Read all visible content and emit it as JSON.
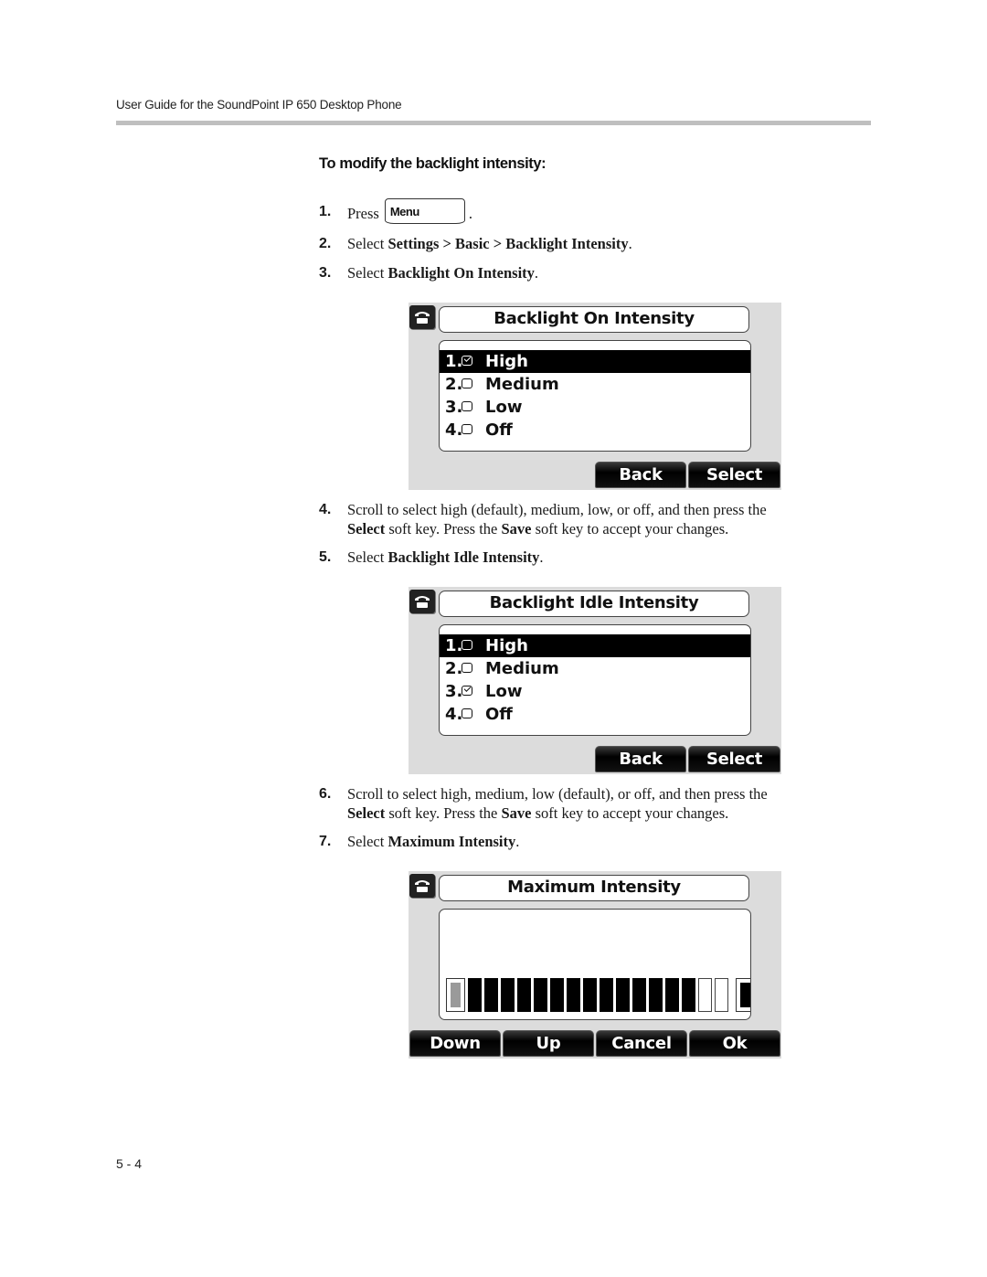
{
  "header": {
    "running_title": "User Guide for the SoundPoint IP 650 Desktop Phone"
  },
  "procedure": {
    "title": "To modify the backlight intensity:",
    "steps": [
      {
        "num": "1.",
        "pre": "Press",
        "key_label": "Menu",
        "post": "."
      },
      {
        "num": "2.",
        "pre": "Select ",
        "bold": "Settings > Basic > Backlight Intensity",
        "post": "."
      },
      {
        "num": "3.",
        "pre": "Select ",
        "bold": "Backlight On Intensity",
        "post": "."
      },
      {
        "num": "4.",
        "line1": "Scroll to select high (default), medium, low, or off, and then press the",
        "bold1": "Select",
        "mid": " soft key. Press the ",
        "bold2": "Save",
        "post": " soft key to accept your changes."
      },
      {
        "num": "5.",
        "pre": "Select ",
        "bold": "Backlight Idle Intensity",
        "post": "."
      },
      {
        "num": "6.",
        "line1": "Scroll to select high, medium, low (default), or off, and then press the",
        "bold1": "Select",
        "mid": " soft key. Press the ",
        "bold2": "Save",
        "post": " soft key to accept your changes."
      },
      {
        "num": "7.",
        "pre": "Select ",
        "bold": "Maximum Intensity",
        "post": "."
      }
    ]
  },
  "screens": [
    {
      "title": "Backlight On Intensity",
      "icon": "phone-handset-icon",
      "options": [
        {
          "idx": "1.",
          "label": "High",
          "checked": true,
          "highlighted": true
        },
        {
          "idx": "2.",
          "label": "Medium",
          "checked": false,
          "highlighted": false
        },
        {
          "idx": "3.",
          "label": "Low",
          "checked": false,
          "highlighted": false
        },
        {
          "idx": "4.",
          "label": "Off",
          "checked": false,
          "highlighted": false
        }
      ],
      "softkeys": [
        "Back",
        "Select"
      ]
    },
    {
      "title": "Backlight Idle Intensity",
      "icon": "phone-handset-icon",
      "options": [
        {
          "idx": "1.",
          "label": "High",
          "checked": false,
          "highlighted": true
        },
        {
          "idx": "2.",
          "label": "Medium",
          "checked": false,
          "highlighted": false
        },
        {
          "idx": "3.",
          "label": "Low",
          "checked": true,
          "highlighted": false
        },
        {
          "idx": "4.",
          "label": "Off",
          "checked": false,
          "highlighted": false
        }
      ],
      "softkeys": [
        "Back",
        "Select"
      ]
    },
    {
      "title": "Maximum Intensity",
      "icon": "phone-handset-icon",
      "intensity": {
        "level": 14,
        "max": 16
      },
      "softkeys": [
        "Down",
        "Up",
        "Cancel",
        "Ok"
      ]
    }
  ],
  "footer": {
    "page_number": "5 - 4"
  }
}
